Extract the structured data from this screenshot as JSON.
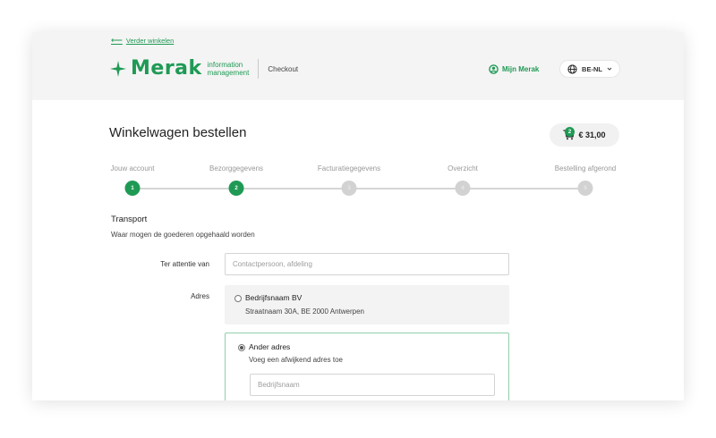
{
  "header": {
    "back_link": "Verder winkelen",
    "logo_word": "Merak",
    "logo_sub_line1": "information",
    "logo_sub_line2": "management",
    "checkout": "Checkout",
    "account_label": "Mijn Merak",
    "language": "BE-NL"
  },
  "page": {
    "title": "Winkelwagen bestellen"
  },
  "cart": {
    "count": "2",
    "total": "€ 31,00"
  },
  "steps": [
    {
      "label": "Jouw account",
      "number": "1",
      "state": "done"
    },
    {
      "label": "Bezorggegevens",
      "number": "2",
      "state": "active"
    },
    {
      "label": "Facturatiegegevens",
      "number": "3",
      "state": "todo"
    },
    {
      "label": "Overzicht",
      "number": "4",
      "state": "todo"
    },
    {
      "label": "Bestelling afgerond",
      "number": "5",
      "state": "todo"
    }
  ],
  "transport": {
    "title": "Transport",
    "subtitle": "Waar mogen de goederen opgehaald worden",
    "attention_label": "Ter attentie van",
    "attention_placeholder": "Contactpersoon, afdeling",
    "attention_value": "",
    "address_label": "Adres",
    "saved_address": {
      "name": "Bedrijfsnaam BV",
      "line": "Straatnaam 30A, BE 2000 Antwerpen",
      "selected": false
    },
    "other_address": {
      "title": "Ander adres",
      "subtitle": "Voeg een afwijkend adres toe",
      "selected": true,
      "company_placeholder": "Bedrijfsnaam",
      "company_value": ""
    }
  },
  "colors": {
    "brand_green": "#1f9a55",
    "inactive_step": "#d2d2d2",
    "header_bg": "#f4f4f4"
  }
}
